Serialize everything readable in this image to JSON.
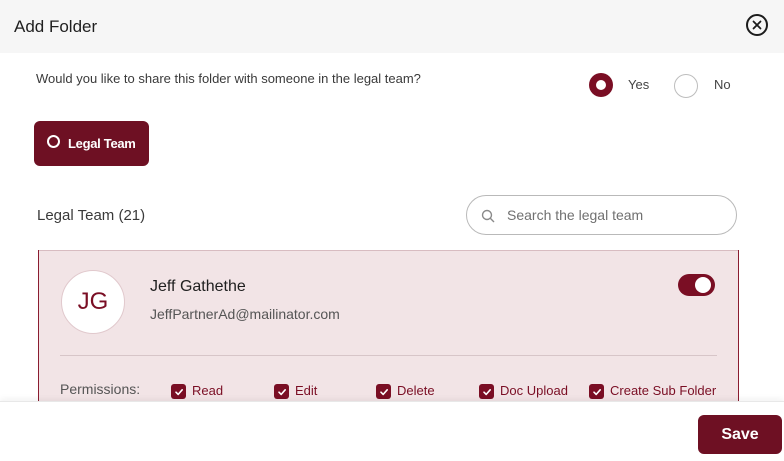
{
  "modal": {
    "title": "Add Folder"
  },
  "share": {
    "question": "Would you like to share this folder with someone in the legal team?",
    "options": [
      {
        "label": "Yes",
        "selected": true
      },
      {
        "label": "No",
        "selected": false
      }
    ]
  },
  "team_chip": {
    "label": "Legal Team"
  },
  "team_list": {
    "heading": "Legal Team (21)"
  },
  "search": {
    "placeholder": "Search the legal team",
    "value": ""
  },
  "members": [
    {
      "initials": "JG",
      "name": "Jeff Gathethe",
      "email": "JeffPartnerAd@mailinator.com",
      "enabled": true,
      "permissions_label": "Permissions:",
      "permissions": [
        {
          "label": "Read",
          "checked": true
        },
        {
          "label": "Edit",
          "checked": true
        },
        {
          "label": "Delete",
          "checked": true
        },
        {
          "label": "Doc Upload",
          "checked": true
        },
        {
          "label": "Create Sub Folder",
          "checked": true
        }
      ]
    }
  ],
  "footer": {
    "save_label": "Save"
  },
  "colors": {
    "accent": "#7a0e24",
    "card_bg": "#f2e4e6",
    "header_bg": "#f6f6f6"
  },
  "icons": [
    "close-icon",
    "search-icon",
    "check-icon",
    "radio-ring-icon"
  ]
}
